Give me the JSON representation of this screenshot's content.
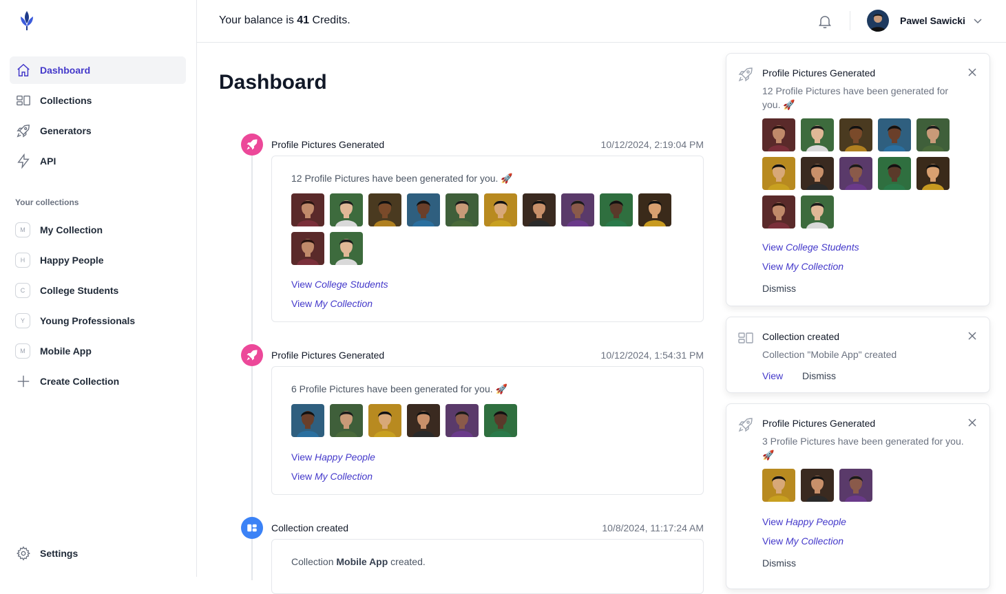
{
  "sidebar": {
    "nav": [
      {
        "label": "Dashboard",
        "icon": "home-icon",
        "active": true
      },
      {
        "label": "Collections",
        "icon": "collections-icon"
      },
      {
        "label": "Generators",
        "icon": "rocket-icon"
      },
      {
        "label": "API",
        "icon": "bolt-icon"
      }
    ],
    "section_title": "Your collections",
    "collections": [
      {
        "letter": "M",
        "label": "My Collection"
      },
      {
        "letter": "H",
        "label": "Happy People"
      },
      {
        "letter": "C",
        "label": "College Students"
      },
      {
        "letter": "Y",
        "label": "Young Professionals"
      },
      {
        "letter": "M",
        "label": "Mobile App"
      }
    ],
    "create_label": "Create Collection",
    "settings_label": "Settings"
  },
  "topbar": {
    "balance_prefix": "Your balance is ",
    "balance_value": "41",
    "balance_suffix": " Credits.",
    "user_name": "Pawel Sawicki"
  },
  "page_title": "Dashboard",
  "events": [
    {
      "title": "Profile Pictures Generated",
      "time": "10/12/2024, 2:19:04 PM",
      "text": "12 Profile Pictures have been generated for you. 🚀",
      "link1_prefix": "View ",
      "link1_name": "College Students",
      "link2_prefix": "View ",
      "link2_name": "My Collection"
    },
    {
      "title": "Profile Pictures Generated",
      "time": "10/12/2024, 1:54:31 PM",
      "text": "6 Profile Pictures have been generated for you. 🚀",
      "link1_prefix": "View ",
      "link1_name": "Happy People",
      "link2_prefix": "View ",
      "link2_name": "My Collection"
    },
    {
      "title": "Collection created",
      "time": "10/8/2024, 11:17:24 AM",
      "text_prefix": "Collection ",
      "text_bold": "Mobile App",
      "text_suffix": " created."
    }
  ],
  "notifications": [
    {
      "title": "Profile Pictures Generated",
      "body": "12 Profile Pictures have been generated for you. 🚀",
      "link1_prefix": "View ",
      "link1_name": "College Students",
      "link2_prefix": "View ",
      "link2_name": "My Collection",
      "dismiss": "Dismiss"
    },
    {
      "title": "Collection created",
      "body": "Collection \"Mobile App\" created",
      "view": "View",
      "dismiss": "Dismiss"
    },
    {
      "title": "Profile Pictures Generated",
      "body": "3 Profile Pictures have been generated for you. 🚀",
      "link1_prefix": "View ",
      "link1_name": "Happy People",
      "link2_prefix": "View ",
      "link2_name": "My Collection",
      "dismiss": "Dismiss"
    }
  ],
  "colors": {
    "accent": "#4338ca",
    "pink_dot": "#ec4899",
    "blue_dot": "#3b82f6"
  }
}
